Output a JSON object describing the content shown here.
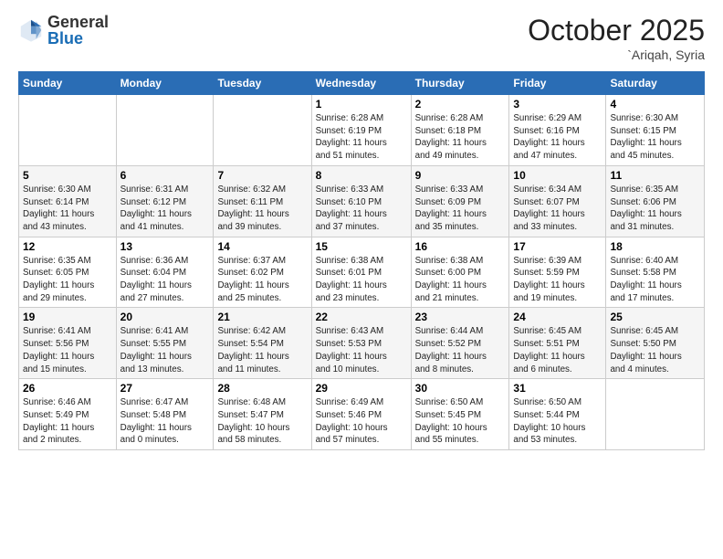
{
  "header": {
    "logo_general": "General",
    "logo_blue": "Blue",
    "month_title": "October 2025",
    "location": "`Ariqah, Syria"
  },
  "days_of_week": [
    "Sunday",
    "Monday",
    "Tuesday",
    "Wednesday",
    "Thursday",
    "Friday",
    "Saturday"
  ],
  "weeks": [
    [
      {
        "day": "",
        "info": ""
      },
      {
        "day": "",
        "info": ""
      },
      {
        "day": "",
        "info": ""
      },
      {
        "day": "1",
        "info": "Sunrise: 6:28 AM\nSunset: 6:19 PM\nDaylight: 11 hours\nand 51 minutes."
      },
      {
        "day": "2",
        "info": "Sunrise: 6:28 AM\nSunset: 6:18 PM\nDaylight: 11 hours\nand 49 minutes."
      },
      {
        "day": "3",
        "info": "Sunrise: 6:29 AM\nSunset: 6:16 PM\nDaylight: 11 hours\nand 47 minutes."
      },
      {
        "day": "4",
        "info": "Sunrise: 6:30 AM\nSunset: 6:15 PM\nDaylight: 11 hours\nand 45 minutes."
      }
    ],
    [
      {
        "day": "5",
        "info": "Sunrise: 6:30 AM\nSunset: 6:14 PM\nDaylight: 11 hours\nand 43 minutes."
      },
      {
        "day": "6",
        "info": "Sunrise: 6:31 AM\nSunset: 6:12 PM\nDaylight: 11 hours\nand 41 minutes."
      },
      {
        "day": "7",
        "info": "Sunrise: 6:32 AM\nSunset: 6:11 PM\nDaylight: 11 hours\nand 39 minutes."
      },
      {
        "day": "8",
        "info": "Sunrise: 6:33 AM\nSunset: 6:10 PM\nDaylight: 11 hours\nand 37 minutes."
      },
      {
        "day": "9",
        "info": "Sunrise: 6:33 AM\nSunset: 6:09 PM\nDaylight: 11 hours\nand 35 minutes."
      },
      {
        "day": "10",
        "info": "Sunrise: 6:34 AM\nSunset: 6:07 PM\nDaylight: 11 hours\nand 33 minutes."
      },
      {
        "day": "11",
        "info": "Sunrise: 6:35 AM\nSunset: 6:06 PM\nDaylight: 11 hours\nand 31 minutes."
      }
    ],
    [
      {
        "day": "12",
        "info": "Sunrise: 6:35 AM\nSunset: 6:05 PM\nDaylight: 11 hours\nand 29 minutes."
      },
      {
        "day": "13",
        "info": "Sunrise: 6:36 AM\nSunset: 6:04 PM\nDaylight: 11 hours\nand 27 minutes."
      },
      {
        "day": "14",
        "info": "Sunrise: 6:37 AM\nSunset: 6:02 PM\nDaylight: 11 hours\nand 25 minutes."
      },
      {
        "day": "15",
        "info": "Sunrise: 6:38 AM\nSunset: 6:01 PM\nDaylight: 11 hours\nand 23 minutes."
      },
      {
        "day": "16",
        "info": "Sunrise: 6:38 AM\nSunset: 6:00 PM\nDaylight: 11 hours\nand 21 minutes."
      },
      {
        "day": "17",
        "info": "Sunrise: 6:39 AM\nSunset: 5:59 PM\nDaylight: 11 hours\nand 19 minutes."
      },
      {
        "day": "18",
        "info": "Sunrise: 6:40 AM\nSunset: 5:58 PM\nDaylight: 11 hours\nand 17 minutes."
      }
    ],
    [
      {
        "day": "19",
        "info": "Sunrise: 6:41 AM\nSunset: 5:56 PM\nDaylight: 11 hours\nand 15 minutes."
      },
      {
        "day": "20",
        "info": "Sunrise: 6:41 AM\nSunset: 5:55 PM\nDaylight: 11 hours\nand 13 minutes."
      },
      {
        "day": "21",
        "info": "Sunrise: 6:42 AM\nSunset: 5:54 PM\nDaylight: 11 hours\nand 11 minutes."
      },
      {
        "day": "22",
        "info": "Sunrise: 6:43 AM\nSunset: 5:53 PM\nDaylight: 11 hours\nand 10 minutes."
      },
      {
        "day": "23",
        "info": "Sunrise: 6:44 AM\nSunset: 5:52 PM\nDaylight: 11 hours\nand 8 minutes."
      },
      {
        "day": "24",
        "info": "Sunrise: 6:45 AM\nSunset: 5:51 PM\nDaylight: 11 hours\nand 6 minutes."
      },
      {
        "day": "25",
        "info": "Sunrise: 6:45 AM\nSunset: 5:50 PM\nDaylight: 11 hours\nand 4 minutes."
      }
    ],
    [
      {
        "day": "26",
        "info": "Sunrise: 6:46 AM\nSunset: 5:49 PM\nDaylight: 11 hours\nand 2 minutes."
      },
      {
        "day": "27",
        "info": "Sunrise: 6:47 AM\nSunset: 5:48 PM\nDaylight: 11 hours\nand 0 minutes."
      },
      {
        "day": "28",
        "info": "Sunrise: 6:48 AM\nSunset: 5:47 PM\nDaylight: 10 hours\nand 58 minutes."
      },
      {
        "day": "29",
        "info": "Sunrise: 6:49 AM\nSunset: 5:46 PM\nDaylight: 10 hours\nand 57 minutes."
      },
      {
        "day": "30",
        "info": "Sunrise: 6:50 AM\nSunset: 5:45 PM\nDaylight: 10 hours\nand 55 minutes."
      },
      {
        "day": "31",
        "info": "Sunrise: 6:50 AM\nSunset: 5:44 PM\nDaylight: 10 hours\nand 53 minutes."
      },
      {
        "day": "",
        "info": ""
      }
    ]
  ]
}
